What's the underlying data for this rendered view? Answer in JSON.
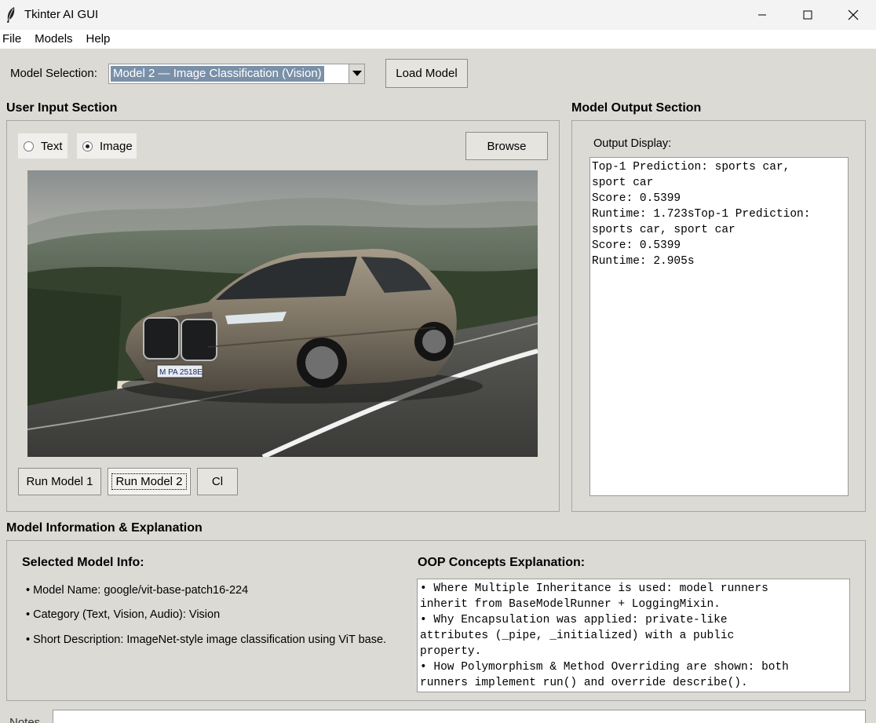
{
  "window": {
    "title": "Tkinter AI GUI"
  },
  "menu": [
    "File",
    "Models",
    "Help"
  ],
  "model_selection": {
    "label": "Model Selection:",
    "selected": "Model 2 — Image Classification (Vision)",
    "load_button": "Load Model"
  },
  "input_section": {
    "title": "User Input Section",
    "radio_text": "Text",
    "radio_image": "Image",
    "selected_input": "Image",
    "browse_button": "Browse",
    "run_model_1": "Run Model 1",
    "run_model_2": "Run Model 2",
    "clear_button": "Cl"
  },
  "output_section": {
    "title": "Model Output Section",
    "display_label": "Output Display:",
    "output_text": "Top-1 Prediction: sports car,\nsport car\nScore: 0.5399\nRuntime: 1.723sTop-1 Prediction:\nsports car, sport car\nScore: 0.5399\nRuntime: 2.905s"
  },
  "info_section": {
    "title": "Model Information & Explanation",
    "selected_model_title": "Selected Model Info:",
    "model_name": "• Model Name: google/vit-base-patch16-224",
    "category": "• Category (Text, Vision, Audio): Vision",
    "description": "• Short Description: ImageNet-style image classification using ViT base.",
    "oop_title": "OOP Concepts Explanation:",
    "oop_text": "• Where Multiple Inheritance is used: model runners\ninherit from BaseModelRunner + LoggingMixin.\n• Why Encapsulation was applied: private-like\nattributes (_pipe, _initialized) with a public\nproperty.\n• How Polymorphism & Method Overriding are shown: both\nrunners implement run() and override describe()."
  },
  "notes": {
    "label": "Notes"
  }
}
